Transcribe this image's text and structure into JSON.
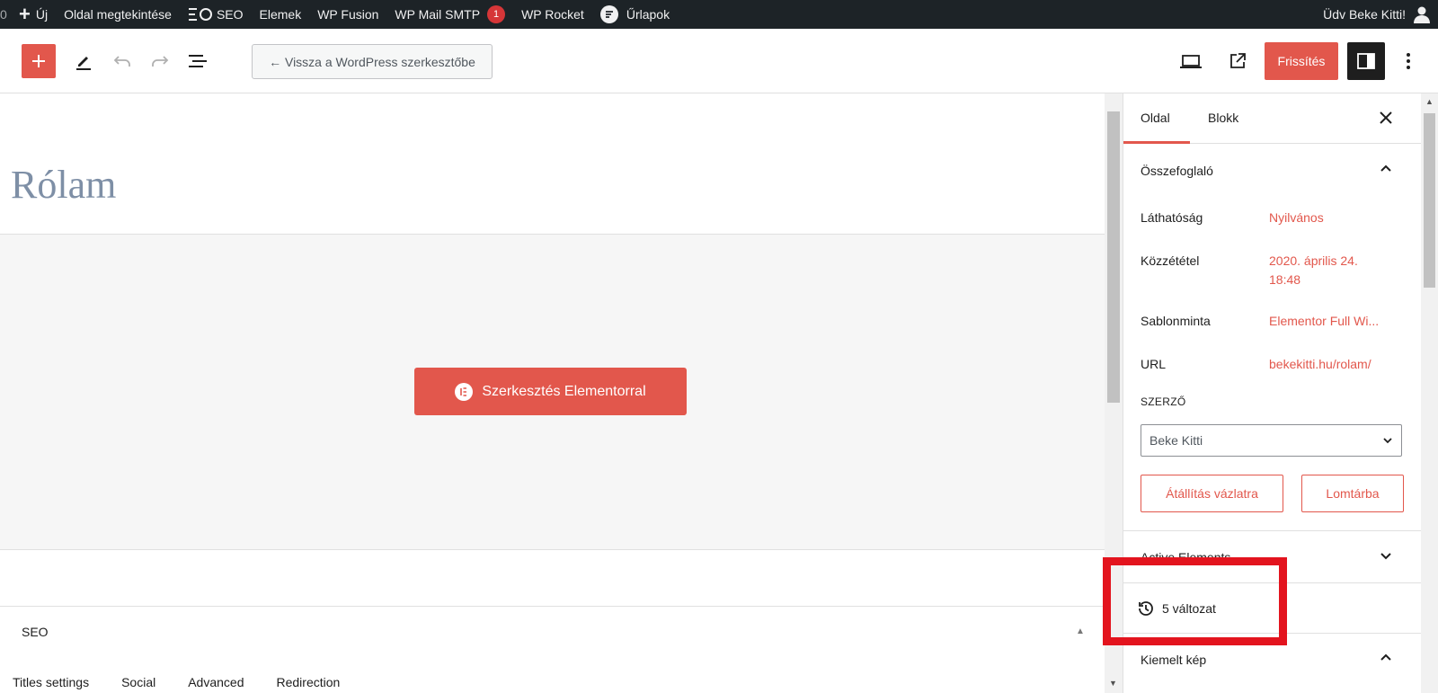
{
  "adminbar": {
    "partial_left": "0",
    "new_label": "Új",
    "view_page": "Oldal megtekintése",
    "seo": "SEO",
    "elements": "Elemek",
    "wp_fusion": "WP Fusion",
    "wp_mail_smtp": "WP Mail SMTP",
    "wp_mail_smtp_badge": "1",
    "wp_rocket": "WP Rocket",
    "forms": "Űrlapok",
    "greeting": "Üdv Beke Kitti!"
  },
  "header": {
    "back_button": "← Vissza a WordPress szerkesztőbe",
    "publish_button": "Frissítés"
  },
  "content": {
    "page_title": "Rólam",
    "elementor_button": "Szerkesztés Elementorral",
    "seo": {
      "title": "SEO",
      "tabs": [
        "Titles settings",
        "Social",
        "Advanced",
        "Redirection"
      ]
    }
  },
  "sidebar": {
    "tabs": [
      "Oldal",
      "Blokk"
    ],
    "summary": {
      "title": "Összefoglaló",
      "rows": [
        {
          "label": "Láthatóság",
          "value": "Nyilvános"
        },
        {
          "label": "Közzététel",
          "value": "2020. április 24. 18:48"
        },
        {
          "label": "Sablonminta",
          "value": "Elementor Full Wi..."
        },
        {
          "label": "URL",
          "value": "bekekitti.hu/rolam/"
        }
      ],
      "author_label": "SZERZŐ",
      "author_value": "Beke Kitti",
      "switch_draft_button": "Átállítás vázlatra",
      "trash_button": "Lomtárba"
    },
    "active_elements": "Active Elements",
    "revisions": "5 változat",
    "featured_image": "Kiemelt kép"
  },
  "colors": {
    "accent": "#e2574c",
    "adminbar_bg": "#1d2327",
    "highlight": "#e3141e"
  }
}
